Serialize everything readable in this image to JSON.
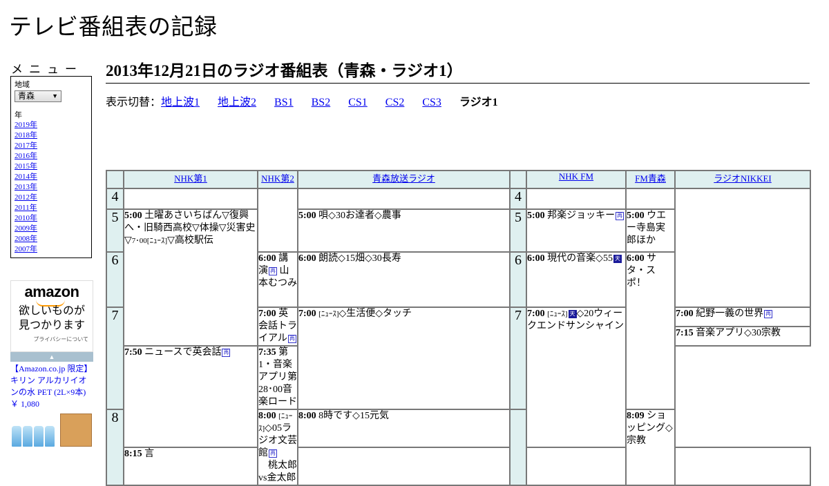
{
  "site": {
    "title": "テレビ番組表の記録"
  },
  "menu": {
    "title": "メニュー",
    "region_label": "地域",
    "region_value": "青森",
    "year_label": "年",
    "years": [
      "2019年",
      "2018年",
      "2017年",
      "2016年",
      "2015年",
      "2014年",
      "2013年",
      "2012年",
      "2011年",
      "2010年",
      "2009年",
      "2008年",
      "2007年"
    ]
  },
  "ad": {
    "logo": "amazon",
    "copy_line1": "欲しいものが",
    "copy_line2": "見つかります",
    "privacy": "プライバシーについて",
    "product": "【Amazon.co.jp 限定】キリン アルカリイオンの水 PET (2L×9本)",
    "price": "￥ 1,080"
  },
  "page": {
    "title": "2013年12月21日のラジオ番組表（青森・ラジオ1）"
  },
  "switcher": {
    "label": "表示切替：",
    "links": [
      "地上波1",
      "地上波2",
      "BS1",
      "BS2",
      "CS1",
      "CS2",
      "CS3"
    ],
    "current": "ラジオ1"
  },
  "schedule": {
    "channels": [
      "NHK第1",
      "NHK第2",
      "青森放送ラジオ",
      "NHK FM",
      "FM青森",
      "ラジオNIKKEI"
    ],
    "hours": [
      "4",
      "5",
      "6",
      "7",
      "8"
    ],
    "programs": {
      "nhk1_500": {
        "time": "5:00",
        "text": "土曜あさいちばん▽復興へ・旧騎西高校▽体操▽災害史▽",
        "small": "7･00[ﾆｭｰｽ]",
        "text2": "▽高校駅伝"
      },
      "nhk1_800": {
        "time": "8:00",
        "small": "[ﾆｭｰｽ]",
        "text": "◇05ラジオ文芸館",
        "badge": "再",
        "text2": "　桃太郎vs金太郎"
      },
      "nhk2_600": {
        "time": "6:00",
        "text": "講演",
        "badge": "再",
        "text2": "山本むつみ"
      },
      "nhk2_700": {
        "time": "7:00",
        "text": "英会話トライアル",
        "badge": "再"
      },
      "nhk2_750": {
        "time": "7:50",
        "text": "ニュースで英会話",
        "badge": "再"
      },
      "nhk2_815": {
        "time": "8:15",
        "text": "言"
      },
      "rab_500": {
        "time": "5:00",
        "text": "唄◇30お達者◇農事"
      },
      "rab_600": {
        "time": "6:00",
        "text": "朗読◇15畑◇30長寿"
      },
      "rab_700": {
        "time": "7:00",
        "small": "[ﾆｭｰｽ]",
        "text": "◇生活便◇タッチ"
      },
      "rab_800": {
        "time": "8:00",
        "text": "8時です◇15元気"
      },
      "fm_500": {
        "time": "5:00",
        "text": "邦楽ジョッキー",
        "badge": "再"
      },
      "fm_600": {
        "time": "6:00",
        "text": "現代の音楽◇55",
        "badge": "天"
      },
      "fm_700": {
        "time": "7:00",
        "small": "[ﾆｭｰｽ]",
        "badge": "天",
        "text": "◇20ウィークエンドサンシャイン"
      },
      "fma_500": {
        "time": "5:00",
        "text": "ウエー寺島実郎ほか"
      },
      "fma_600": {
        "time": "6:00",
        "text": "サタ・スポ！"
      },
      "nikkei_700": {
        "time": "7:00",
        "text": "紀野一義の世界",
        "badge": "再"
      },
      "nikkei_715": {
        "time": "7:15",
        "text": "音楽アプリ◇30宗教"
      },
      "nikkei_735": {
        "time": "7:35",
        "text": "第1・音楽アプリ第28･00音楽ロード"
      },
      "nikkei_809": {
        "time": "8:09",
        "text": "ショッピング◇宗教"
      }
    }
  }
}
